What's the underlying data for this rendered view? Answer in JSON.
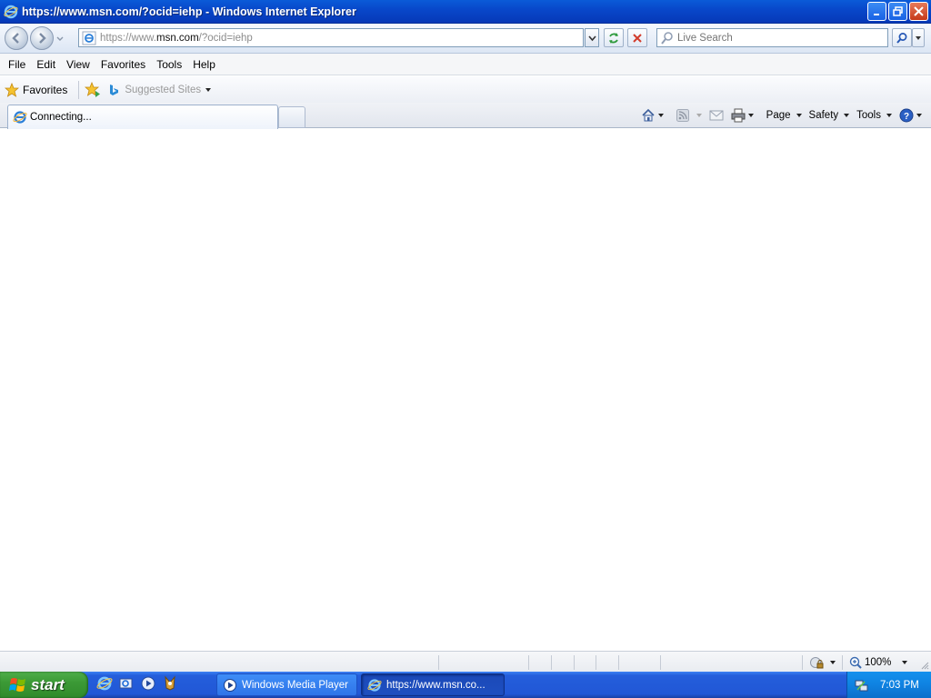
{
  "window": {
    "title": "https://www.msn.com/?ocid=iehp - Windows Internet Explorer"
  },
  "address_bar": {
    "url_prefix": "https://www.",
    "url_host": "msn.com",
    "url_suffix": "/?ocid=iehp"
  },
  "search": {
    "placeholder": "Live Search"
  },
  "menu": {
    "items": [
      "File",
      "Edit",
      "View",
      "Favorites",
      "Tools",
      "Help"
    ]
  },
  "favorites_bar": {
    "favorites_label": "Favorites",
    "suggested_sites_label": "Suggested Sites"
  },
  "tab": {
    "label": "Connecting..."
  },
  "command_bar": {
    "page_label": "Page",
    "safety_label": "Safety",
    "tools_label": "Tools"
  },
  "status_bar": {
    "zoom": "100%"
  },
  "taskbar": {
    "start_label": "start",
    "tasks": [
      {
        "label": "Windows Media Player",
        "active": false
      },
      {
        "label": "https://www.msn.co...",
        "active": true
      }
    ],
    "clock": "7:03 PM"
  },
  "colors": {
    "titlebar": "#0846c9",
    "taskbar": "#245edb",
    "start_button": "#3c9a36"
  },
  "icons": [
    "ie-icon",
    "back-icon",
    "forward-icon",
    "refresh-icon",
    "stop-icon",
    "search-icon",
    "favorites-star-icon",
    "add-favorites-icon",
    "bing-icon",
    "home-icon",
    "feeds-icon",
    "read-mail-icon",
    "print-icon",
    "help-icon",
    "zoom-icon",
    "windows-logo-icon"
  ]
}
